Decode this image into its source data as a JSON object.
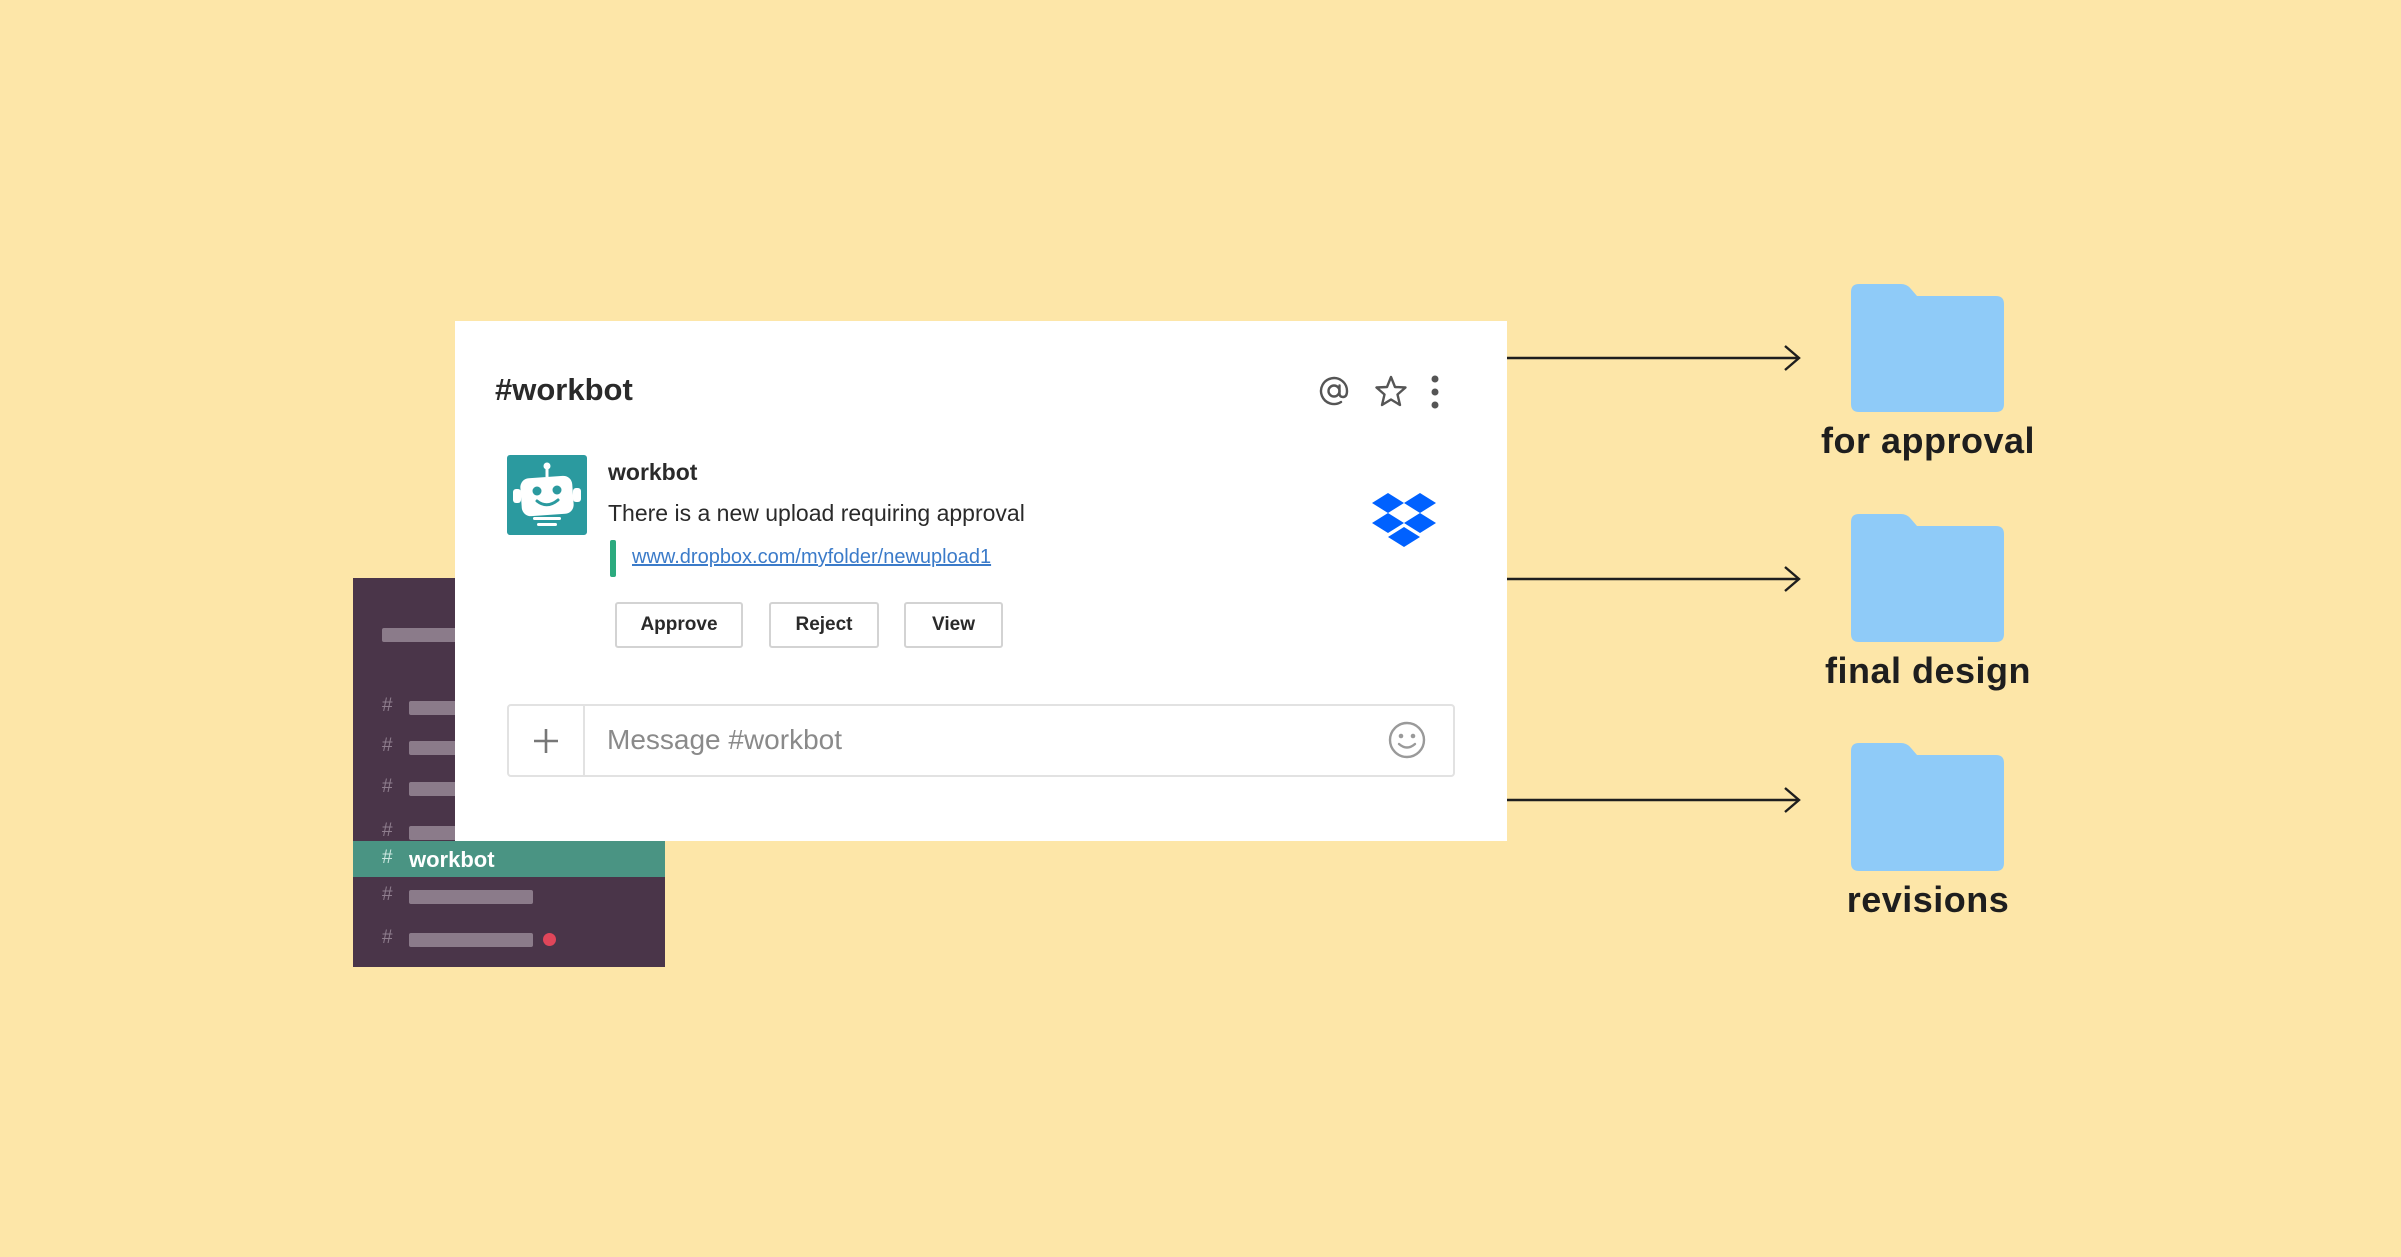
{
  "sidebar": {
    "active_channel": "workbot",
    "hash": "#"
  },
  "chat": {
    "channel_title": "#workbot",
    "header_icons": [
      "at-icon",
      "star-icon",
      "more-vertical-icon"
    ],
    "message": {
      "sender": "workbot",
      "text": "There is a new upload requiring approval",
      "link": "www.dropbox.com/myfolder/newupload1",
      "attachment_icon": "dropbox-icon",
      "actions": [
        "Approve",
        "Reject",
        "View"
      ]
    },
    "composer": {
      "placeholder": "Message #workbot"
    }
  },
  "folders": [
    {
      "label": "for approval"
    },
    {
      "label": "final design"
    },
    {
      "label": "revisions"
    }
  ],
  "colors": {
    "background": "#FDE6A8",
    "sidebar": "#4A3549",
    "sidebar_active": "#4A9483",
    "avatar": "#2B9A9F",
    "folder": "#8FCBF8",
    "link": "#3B7BC9",
    "dropbox": "#0061FF",
    "unread_dot": "#E0465A"
  }
}
